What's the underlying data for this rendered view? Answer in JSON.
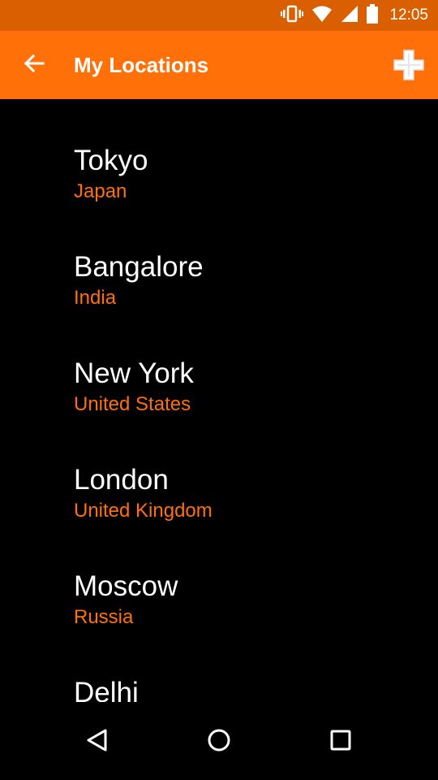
{
  "status_bar": {
    "time": "12:05",
    "icons": [
      "vibrate-icon",
      "wifi-icon",
      "cell-signal-icon",
      "battery-icon"
    ],
    "color": "#d95f00"
  },
  "app_bar": {
    "title": "My Locations",
    "back_icon": "arrow-left-icon",
    "add_icon": "plus-icon",
    "color": "#ff7009"
  },
  "locations": [
    {
      "city": "Tokyo",
      "country": "Japan"
    },
    {
      "city": "Bangalore",
      "country": "India"
    },
    {
      "city": "New York",
      "country": "United States"
    },
    {
      "city": "London",
      "country": "United Kingdom"
    },
    {
      "city": "Moscow",
      "country": "Russia"
    },
    {
      "city": "Delhi",
      "country": ""
    }
  ],
  "nav_bar": {
    "icons": [
      "back-triangle-icon",
      "home-circle-icon",
      "recents-square-icon"
    ]
  },
  "colors": {
    "accent": "#ff7009",
    "background": "#000000",
    "primary_text": "#ffffff"
  }
}
